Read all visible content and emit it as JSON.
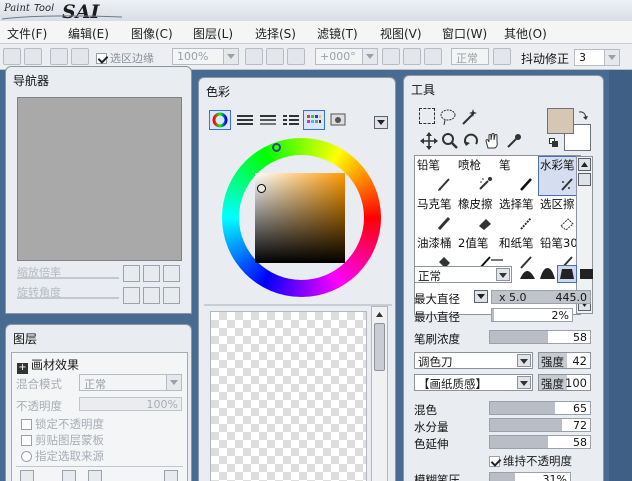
{
  "app": {
    "logo_text": "Paint Tool SAI"
  },
  "menu": [
    {
      "label": "文件(F)"
    },
    {
      "label": "编辑(E)"
    },
    {
      "label": "图像(C)"
    },
    {
      "label": "图层(L)"
    },
    {
      "label": "选择(S)"
    },
    {
      "label": "滤镜(T)"
    },
    {
      "label": "视图(V)"
    },
    {
      "label": "窗口(W)"
    },
    {
      "label": "其他(O)"
    }
  ],
  "toolbar": {
    "select_edge_label": "选区边缘",
    "select_edge_checked": true,
    "zoom_value": "100%",
    "rotation_value": "+000°",
    "blend_value": "正常",
    "stabilizer_label": "抖动修正",
    "stabilizer_value": "3"
  },
  "navigator": {
    "title": "导航器",
    "zoom_label": "缩放倍率",
    "rotate_label": "旋转角度"
  },
  "layers": {
    "title": "图层",
    "paper_effect_label": "画材效果",
    "blend_mode_label": "混合模式",
    "blend_mode_value": "正常",
    "opacity_label": "不透明度",
    "opacity_value": "100%",
    "lock_opacity_label": "锁定不透明度",
    "clip_mask_label": "剪贴图层蒙板",
    "select_source_label": "指定选取来源"
  },
  "color": {
    "title": "色彩",
    "accent": "#3b6fd8"
  },
  "tools": {
    "title": "工具",
    "brushes": [
      {
        "name": "铅笔",
        "icon": "pencil-icon"
      },
      {
        "name": "喷枪",
        "icon": "airbrush-icon"
      },
      {
        "name": "笔",
        "icon": "pen-icon"
      },
      {
        "name": "水彩笔",
        "icon": "watercolor-icon",
        "selected": true
      },
      {
        "name": "马克笔",
        "icon": "marker-icon"
      },
      {
        "name": "橡皮擦",
        "icon": "eraser-icon"
      },
      {
        "name": "选择笔",
        "icon": "select-pen-icon"
      },
      {
        "name": "选区擦",
        "icon": "select-eraser-icon"
      },
      {
        "name": "油漆桶",
        "icon": "bucket-icon"
      },
      {
        "name": "2值笔",
        "icon": "binary-pen-icon"
      },
      {
        "name": "和纸笔",
        "icon": "washi-pen-icon"
      },
      {
        "name": "铅笔30",
        "icon": "pencil-icon"
      }
    ],
    "blend_mode": "正常",
    "max_size_label": "最大直径",
    "max_size_multiplier": "x 5.0",
    "max_size_value": "445.0",
    "min_size_label": "最小直径",
    "min_size_value": "2%",
    "density_label": "笔刷浓度",
    "density_value": "58",
    "shape_value": "调色刀",
    "shape_strength_label": "强度",
    "shape_strength_value": "42",
    "texture_value": "【画纸质感】",
    "texture_strength_label": "强度",
    "texture_strength_value": "100",
    "blending_label": "混色",
    "blending_value": "65",
    "dilution_label": "水分量",
    "dilution_value": "72",
    "persistence_label": "色延伸",
    "persistence_value": "58",
    "keep_opacity_label": "维持不透明度",
    "keep_opacity_checked": true,
    "blur_label": "模糊笔压",
    "blur_value": "31%"
  }
}
